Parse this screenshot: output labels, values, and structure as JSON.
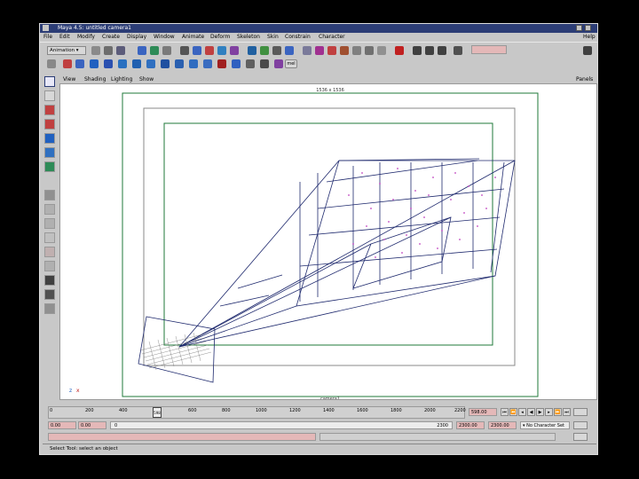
{
  "window": {
    "title": "Maya 4.5: untitled      camera1"
  },
  "menus": [
    "File",
    "Edit",
    "Modify",
    "Create",
    "Display",
    "Window",
    "Animate",
    "Deform",
    "Skeleton",
    "Skin",
    "Constrain",
    "Character",
    "Help"
  ],
  "shelf": {
    "mode": "Animation",
    "mel_label": "mel"
  },
  "panel": {
    "menus": [
      "View",
      "Shading",
      "Lighting",
      "Show"
    ],
    "panels_label": "Panels"
  },
  "viewport": {
    "resolution_label": "1536 x 1536",
    "camera_label": "camera1",
    "axis_z": "z",
    "axis_x": "x"
  },
  "time_slider": {
    "ticks": [
      "0",
      "200",
      "400",
      "600",
      "800",
      "1000",
      "1200",
      "1400",
      "1600",
      "1800",
      "2000",
      "2200"
    ],
    "current": "598.00",
    "marker_label": "598"
  },
  "range": {
    "start": "0.00",
    "inner_start": "0.00",
    "field3": "0",
    "end_time": "2300",
    "range_end": "2300.00",
    "playback_end": "2300.00",
    "char_set": "No Character Set"
  },
  "help_line": "Select Tool: select an object",
  "colors": {
    "titlebar": "#2c3d76",
    "ui_gray": "#c8c8c8",
    "field_red": "#e4b8b8",
    "wire": "#1f2a6e",
    "points": "#c040c0"
  }
}
